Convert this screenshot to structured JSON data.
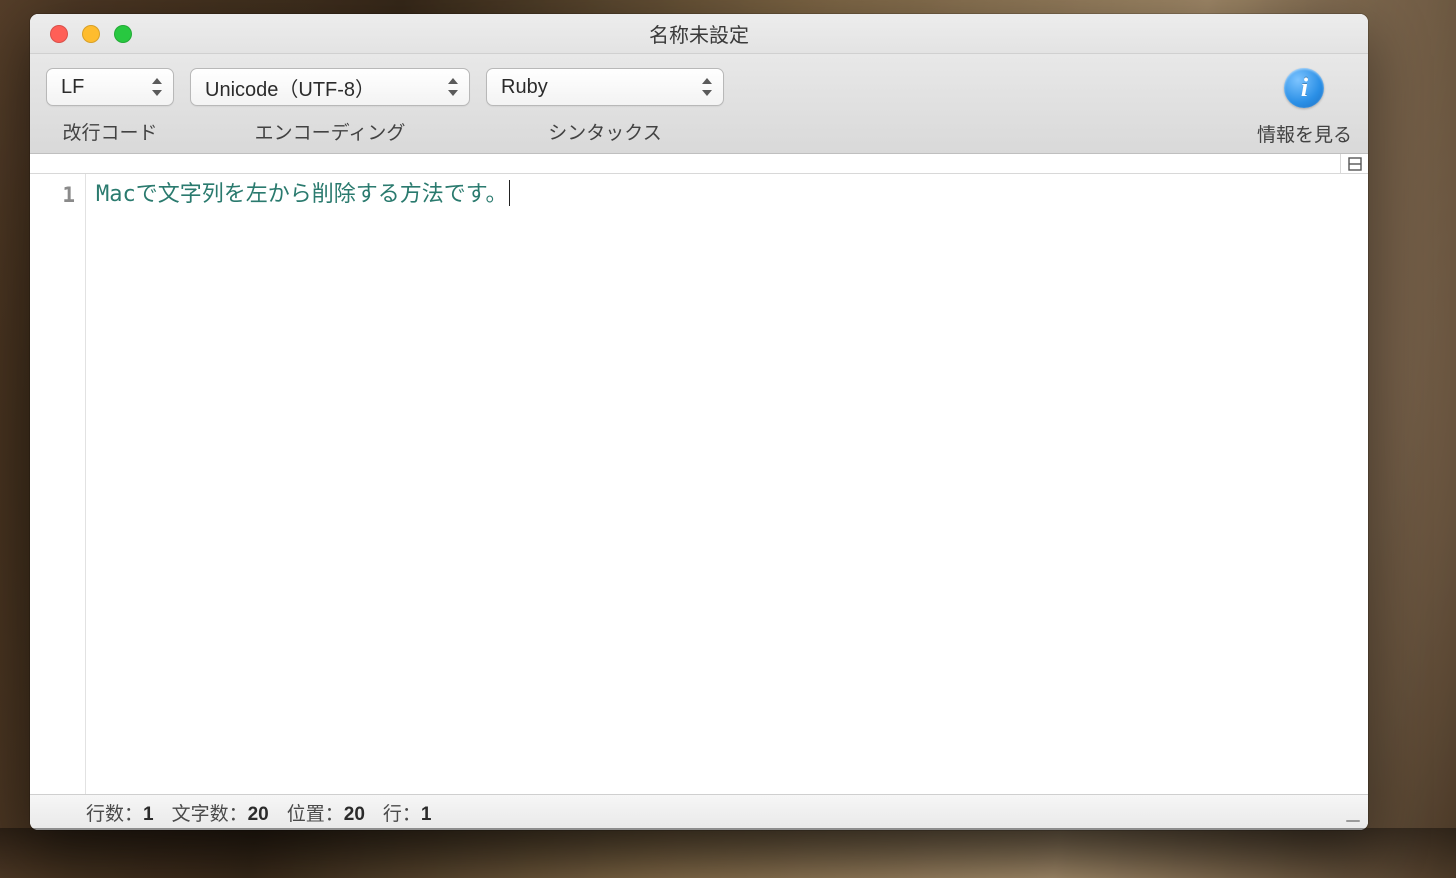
{
  "window": {
    "title": "名称未設定"
  },
  "toolbar": {
    "line_endings": {
      "value": "LF",
      "label": "改行コード"
    },
    "encoding": {
      "value": "Unicode（UTF-8）",
      "label": "エンコーディング"
    },
    "syntax": {
      "value": "Ruby",
      "label": "シンタックス"
    },
    "info": {
      "glyph": "i",
      "label": "情報を見る"
    }
  },
  "editor": {
    "lines": [
      {
        "num": "1",
        "text": "Macで文字列を左から削除する方法です。"
      }
    ]
  },
  "statusbar": {
    "lines_label": "行数：",
    "lines_value": "1",
    "chars_label": "文字数：",
    "chars_value": "20",
    "position_label": "位置：",
    "position_value": "20",
    "line_label": "行：",
    "line_value": "1"
  },
  "colors": {
    "code_text": "#2a7a6e",
    "info_button": "#2a8fe6"
  }
}
